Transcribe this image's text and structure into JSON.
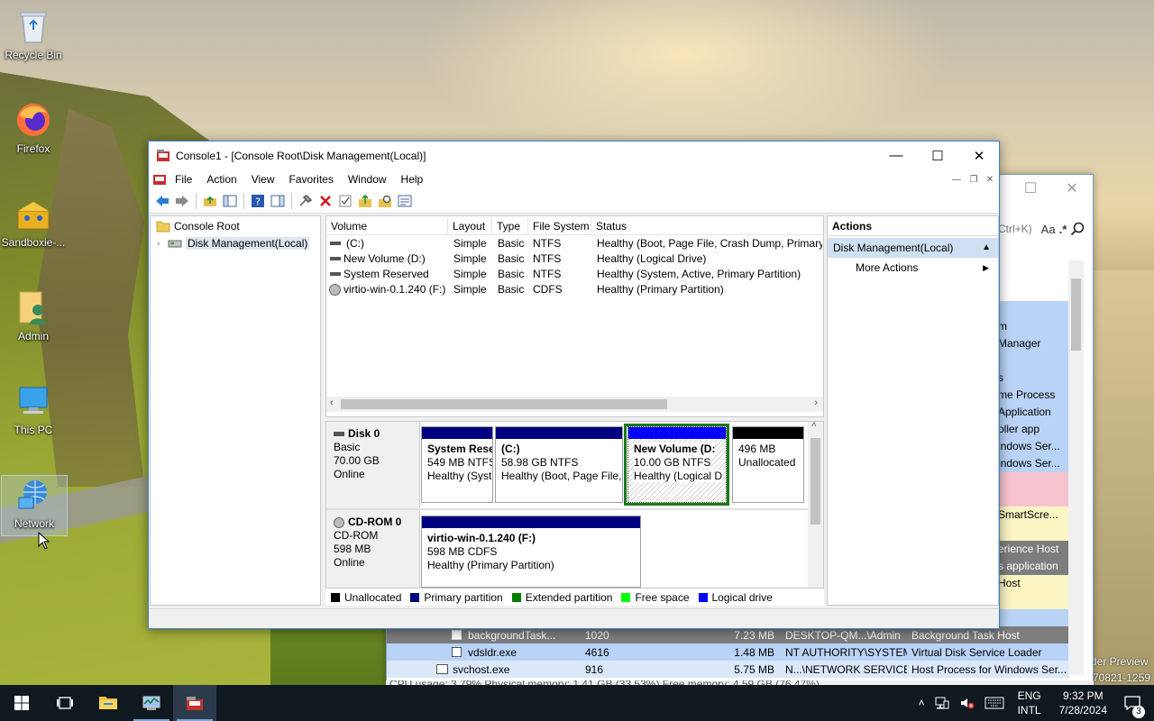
{
  "desktop": {
    "icons": [
      {
        "label": "Recycle Bin",
        "icon": "recycle-bin-icon"
      },
      {
        "label": "Firefox",
        "icon": "firefox-icon"
      },
      {
        "label": "Sandboxie-...",
        "icon": "sandboxie-icon"
      },
      {
        "label": "Admin",
        "icon": "user-folder-icon"
      },
      {
        "label": "This PC",
        "icon": "computer-icon"
      },
      {
        "label": "Network",
        "icon": "network-icon"
      }
    ],
    "watermark_line1": "der Preview",
    "watermark_line2": "70821-1259"
  },
  "taskmanager": {
    "search_hint": "Ctrl+K)",
    "search_aa": "Aa",
    "search_star": ".*",
    "side_descriptions": [
      "m",
      "Manager",
      "s",
      "me Process",
      "Application",
      "oller app",
      "indows Ser...",
      "indows Ser...",
      "",
      " SmartScre...",
      "",
      "erience Host",
      "s application",
      "Host"
    ],
    "rows": [
      {
        "name": "backgroundTask...",
        "pid": "1020",
        "mem": "7.23 MB",
        "user": "DESKTOP-QM...\\Admin",
        "desc": "Background Task Host"
      },
      {
        "name": "vdsldr.exe",
        "pid": "4616",
        "mem": "1.48 MB",
        "user": "NT AUTHORITY\\SYSTEM",
        "desc": "Virtual Disk Service Loader"
      },
      {
        "name": "svchost.exe",
        "pid": "916",
        "mem": "5.75 MB",
        "user": "N...\\NETWORK SERVICE",
        "desc": "Host Process for Windows Ser..."
      }
    ],
    "statusline": "CPU usage: 3.79%    Physical memory: 1.41 GB (33.53%)    Free memory: 4.59 GB (76.47%)"
  },
  "mmc": {
    "title": "Console1 - [Console Root\\Disk Management(Local)]",
    "menu": [
      "File",
      "Action",
      "View",
      "Favorites",
      "Window",
      "Help"
    ],
    "tree": {
      "root": "Console Root",
      "child": "Disk Management(Local)"
    },
    "volume_columns": [
      "Volume",
      "Layout",
      "Type",
      "File System",
      "Status"
    ],
    "volumes": [
      {
        "volume": "(C:)",
        "layout": "Simple",
        "type": "Basic",
        "fs": "NTFS",
        "status": "Healthy (Boot, Page File, Crash Dump, Primary P"
      },
      {
        "volume": "New Volume (D:)",
        "layout": "Simple",
        "type": "Basic",
        "fs": "NTFS",
        "status": "Healthy (Logical Drive)"
      },
      {
        "volume": "System Reserved",
        "layout": "Simple",
        "type": "Basic",
        "fs": "NTFS",
        "status": "Healthy (System, Active, Primary Partition)"
      },
      {
        "volume": "virtio-win-0.1.240 (F:)",
        "layout": "Simple",
        "type": "Basic",
        "fs": "CDFS",
        "status": "Healthy (Primary Partition)"
      }
    ],
    "disks": [
      {
        "name": "Disk 0",
        "kind": "Basic",
        "size": "70.00 GB",
        "state": "Online",
        "partitions": [
          {
            "title": "System Rese",
            "line2": "549 MB NTFS",
            "line3": "Healthy (Syst",
            "color": "#000080"
          },
          {
            "title": "(C:)",
            "line2": "58.98 GB NTFS",
            "line3": "Healthy (Boot, Page File,",
            "color": "#000080"
          },
          {
            "title": "New Volume  (D:",
            "line2": "10.00 GB NTFS",
            "line3": "Healthy (Logical D",
            "color": "#0000ff"
          },
          {
            "title": "",
            "line2": "496 MB",
            "line3": "Unallocated",
            "color": "#000000"
          }
        ]
      },
      {
        "name": "CD-ROM 0",
        "kind": "CD-ROM",
        "size": "598 MB",
        "state": "Online",
        "partitions": [
          {
            "title": "virtio-win-0.1.240  (F:)",
            "line2": "598 MB CDFS",
            "line3": "Healthy (Primary Partition)",
            "color": "#000080"
          }
        ]
      }
    ],
    "legend": [
      {
        "label": "Unallocated",
        "color": "#000000"
      },
      {
        "label": "Primary partition",
        "color": "#000080"
      },
      {
        "label": "Extended partition",
        "color": "#008000"
      },
      {
        "label": "Free space",
        "color": "#00ff00"
      },
      {
        "label": "Logical drive",
        "color": "#0000ff"
      }
    ],
    "actions": {
      "header": "Actions",
      "section": "Disk Management(Local)",
      "more": "More Actions"
    }
  },
  "taskbar": {
    "lang_top": "ENG",
    "lang_bottom": "INTL",
    "time": "9:32 PM",
    "date": "7/28/2024",
    "notifications": "3"
  }
}
